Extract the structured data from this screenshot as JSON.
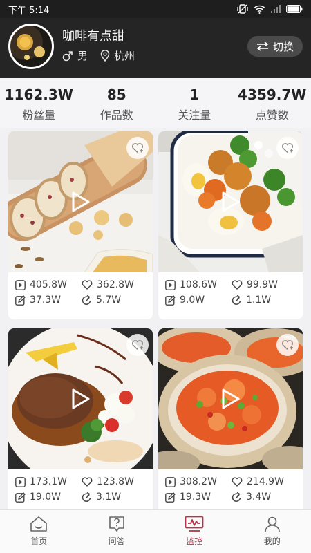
{
  "status_bar": {
    "time": "下午 5:14"
  },
  "profile": {
    "name": "咖啡有点甜",
    "gender": "男",
    "city": "杭州",
    "switch_label": "切换"
  },
  "stats": [
    {
      "value": "1162.3W",
      "label": "粉丝量"
    },
    {
      "value": "85",
      "label": "作品数"
    },
    {
      "value": "1",
      "label": "关注量"
    },
    {
      "value": "4359.7W",
      "label": "点赞数"
    }
  ],
  "cards": [
    {
      "subject": "bread",
      "plays": "405.8W",
      "likes": "362.8W",
      "comments": "37.3W",
      "shares": "5.7W"
    },
    {
      "subject": "chicken-bowl",
      "plays": "108.6W",
      "likes": "99.9W",
      "comments": "9.0W",
      "shares": "1.1W"
    },
    {
      "subject": "steak",
      "plays": "173.1W",
      "likes": "123.8W",
      "comments": "19.0W",
      "shares": "3.1W"
    },
    {
      "subject": "oysters",
      "plays": "308.2W",
      "likes": "214.9W",
      "comments": "19.3W",
      "shares": "3.4W"
    }
  ],
  "nav": [
    {
      "label": "首页",
      "icon": "home-icon",
      "active": false
    },
    {
      "label": "问答",
      "icon": "question-icon",
      "active": false
    },
    {
      "label": "监控",
      "icon": "monitor-icon",
      "active": true
    },
    {
      "label": "我的",
      "icon": "user-icon",
      "active": false
    }
  ],
  "colors": {
    "header_bg": "#252525",
    "accent": "#b0374a",
    "page_bg": "#f1f1f3"
  }
}
